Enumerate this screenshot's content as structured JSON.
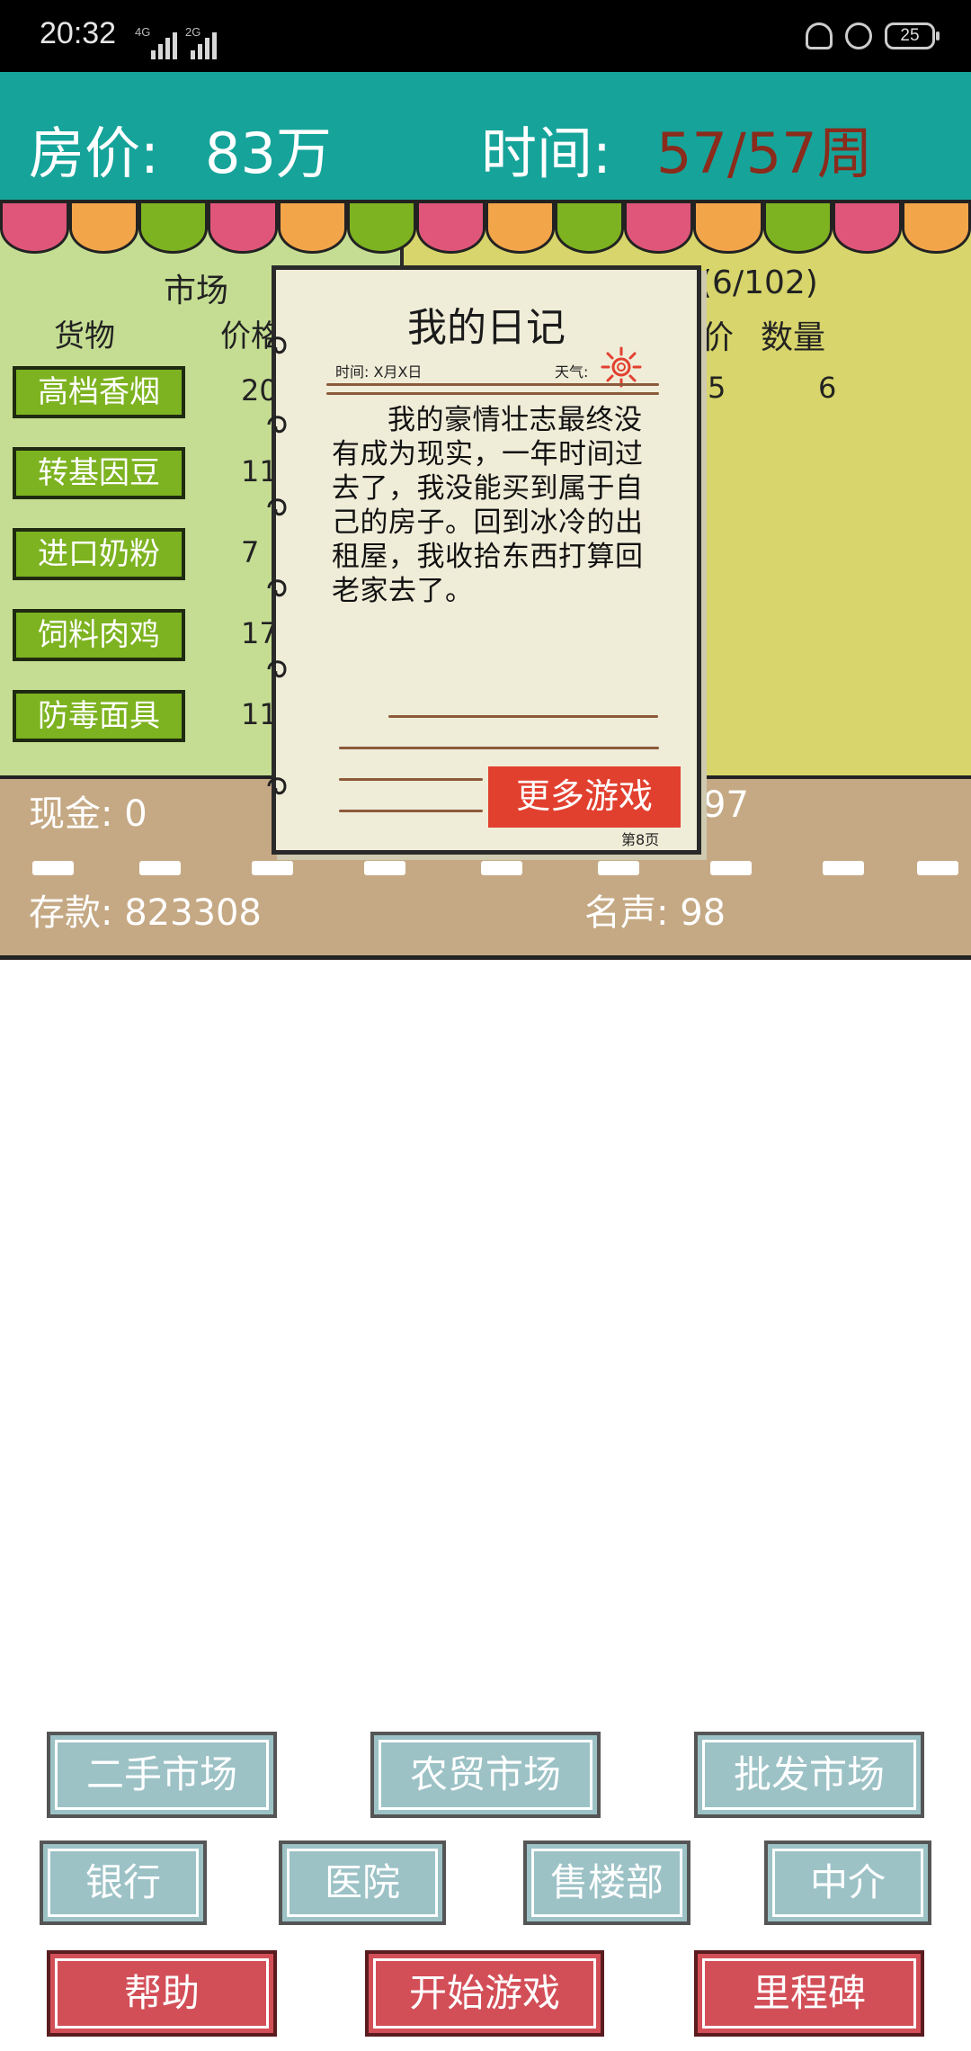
{
  "status_bar": {
    "time": "20:32",
    "network_1": "4G",
    "network_2": "2G",
    "battery": "25"
  },
  "hud": {
    "price_label": "房价:",
    "price_value": "83万",
    "time_label": "时间:",
    "time_value": "57/57周"
  },
  "market": {
    "title": "市场",
    "col_goods": "货物",
    "col_price": "价格",
    "items": [
      {
        "name": "高档香烟",
        "price": "20"
      },
      {
        "name": "转基因豆",
        "price": "11"
      },
      {
        "name": "进口奶粉",
        "price": "7"
      },
      {
        "name": "饲料肉鸡",
        "price": "17"
      },
      {
        "name": "防毒面具",
        "price": "11"
      }
    ]
  },
  "inventory": {
    "capacity": "(6/102)",
    "col_price": "价",
    "col_qty": "数量",
    "row_price": "5",
    "row_qty": "6"
  },
  "stats": {
    "cash": "现金: 0",
    "hidden_value": "97",
    "savings": "存款: 823308",
    "fame": "名声: 98"
  },
  "diary": {
    "title": "我的日记",
    "date": "时间: X月X日",
    "weather": "天气:",
    "body": "我的豪情壮志最终没有成为现实，一年时间过去了，我没能买到属于自己的房子。回到冰冷的出租屋，我收拾东西打算回老家去了。",
    "more_games": "更多游戏",
    "page": "第8页"
  },
  "buttons": {
    "second_hand": "二手市场",
    "farmers_market": "农贸市场",
    "wholesale": "批发市场",
    "bank": "银行",
    "hospital": "医院",
    "sales_office": "售楼部",
    "agency": "中介",
    "help": "帮助",
    "start_game": "开始游戏",
    "milestones": "里程碑"
  },
  "colors": {
    "hud_bg": "#16a49a",
    "market_bg": "#c5dd93",
    "inventory_bg": "#d7d56b",
    "ground": "#c5a984",
    "goods_button": "#7db320",
    "blue_button": "#9cc2c6",
    "red_button": "#d34f58",
    "more_games": "#e2402f"
  }
}
